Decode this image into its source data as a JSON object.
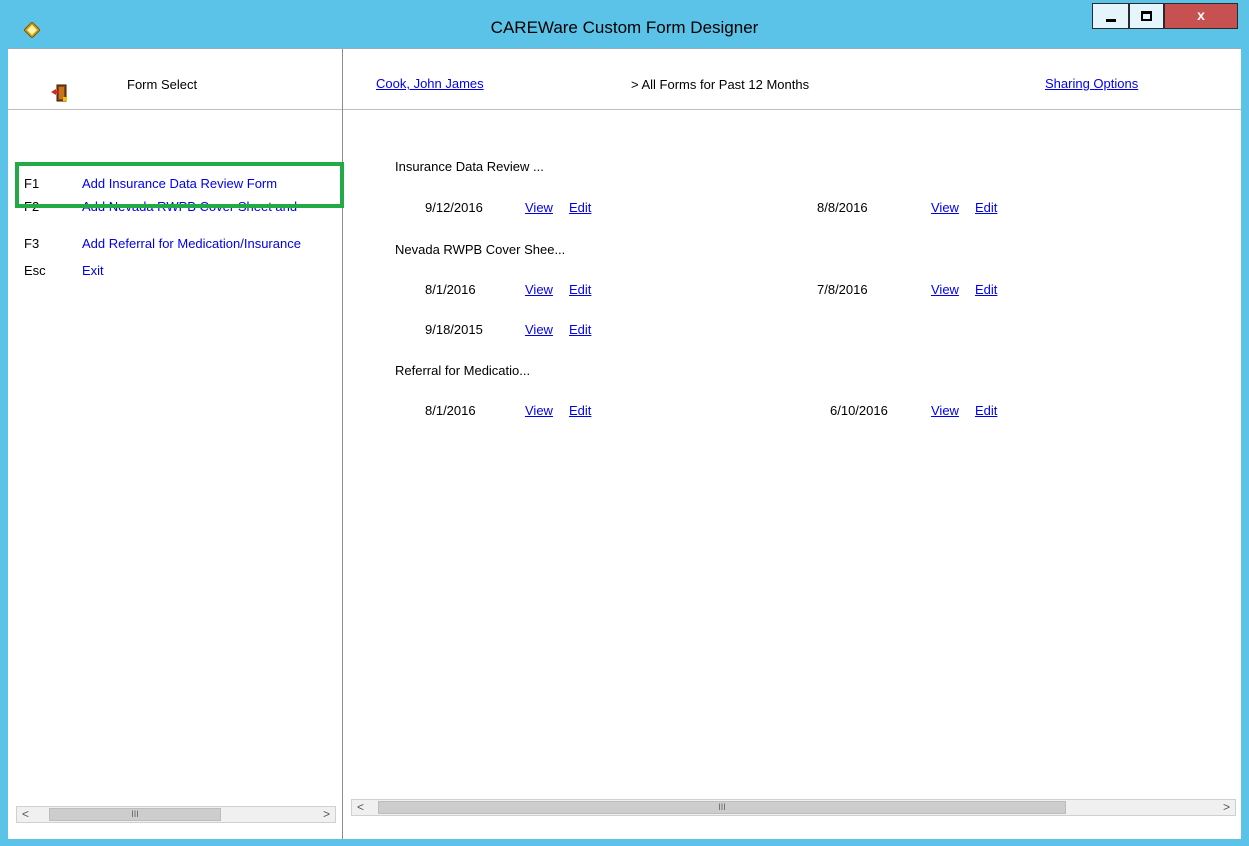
{
  "window": {
    "title": "CAREWare Custom Form Designer",
    "close_glyph": "x"
  },
  "left": {
    "header_label": "Form Select",
    "menu": [
      {
        "key": "F1",
        "label": "Add Insurance Data Review Form"
      },
      {
        "key": "F2",
        "label": "Add Nevada RWPB Cover Sheet and"
      },
      {
        "key": "F3",
        "label": "Add Referral for Medication/Insurance"
      },
      {
        "key": "Esc",
        "label": "Exit"
      }
    ],
    "highlight_color": "#22aa44"
  },
  "right": {
    "client_name": "Cook, John James",
    "breadcrumb": "> All Forms for Past 12 Months",
    "sharing_label": "Sharing Options",
    "view_label": "View",
    "edit_label": "Edit",
    "groups": [
      {
        "title": "Insurance Data Review ...",
        "dates": [
          "9/12/2016",
          "8/8/2016"
        ]
      },
      {
        "title": "Nevada RWPB Cover Shee...",
        "dates": [
          "8/1/2016",
          "7/8/2016",
          "9/18/2015"
        ]
      },
      {
        "title": "Referral for Medicatio...",
        "dates": [
          "8/1/2016",
          "6/10/2016"
        ]
      }
    ]
  },
  "scroll": {
    "left_arrow": "<",
    "right_arrow": ">",
    "thumb_grip": "III"
  },
  "colors": {
    "titlebar": "#5bc2e8",
    "link": "#0000ee",
    "close_button": "#c75050"
  }
}
